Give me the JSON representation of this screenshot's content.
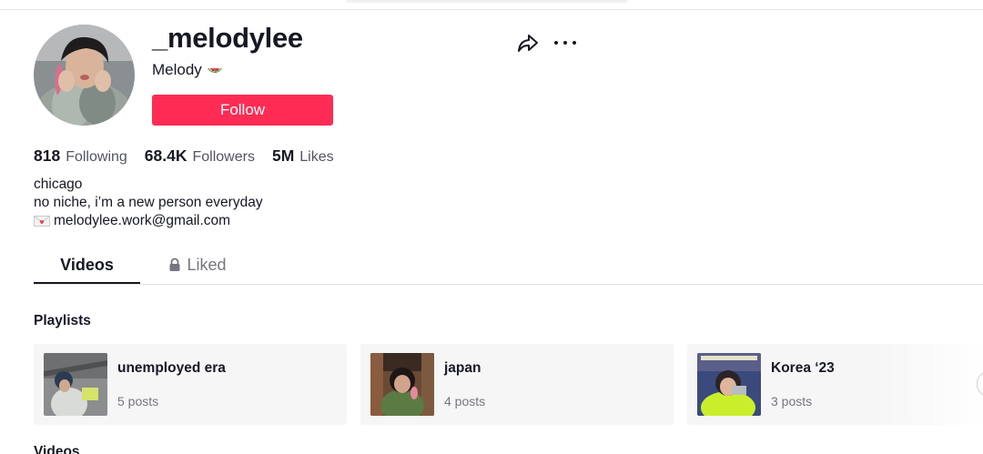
{
  "profile": {
    "username": "_melodylee",
    "nickname": "Melody",
    "nickname_emoji": "watermelon-emoji",
    "follow_label": "Follow",
    "follow_color": "#fe2c55"
  },
  "stats": [
    {
      "value": "818",
      "label": "Following"
    },
    {
      "value": "68.4K",
      "label": "Followers"
    },
    {
      "value": "5M",
      "label": "Likes"
    }
  ],
  "bio": {
    "line1": "chicago",
    "line2": "no niche, i’m a new person everyday",
    "line3_icon": "love-letter-emoji",
    "line3": "melodylee.work@gmail.com"
  },
  "tabs": {
    "videos": "Videos",
    "liked": "Liked"
  },
  "sections": {
    "playlists_title": "Playlists",
    "videos_title": "Videos"
  },
  "playlists": [
    {
      "name": "unemployed era",
      "count": "5 posts"
    },
    {
      "name": "japan",
      "count": "4 posts"
    },
    {
      "name": "Korea ‘23",
      "count": "3 posts"
    }
  ],
  "icons": {
    "share": "share-icon",
    "more": "more-icon",
    "lock": "lock-icon",
    "next": "chevron-right-icon"
  }
}
